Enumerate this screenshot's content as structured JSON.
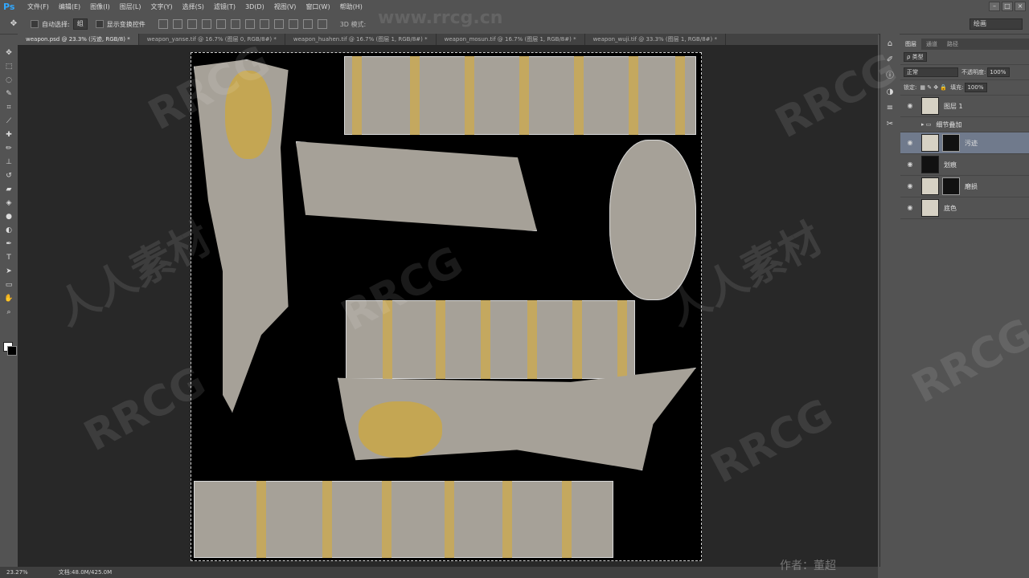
{
  "app": {
    "logo": "Ps"
  },
  "menu": [
    "文件(F)",
    "编辑(E)",
    "图像(I)",
    "图层(L)",
    "文字(Y)",
    "选择(S)",
    "滤镜(T)",
    "3D(D)",
    "视图(V)",
    "窗口(W)",
    "帮助(H)"
  ],
  "window_controls": [
    "–",
    "□",
    "×"
  ],
  "options": {
    "auto_select_label": "自动选择:",
    "auto_select_value": "组",
    "show_transform_label": "显示变换控件",
    "mode3d_label": "3D 模式:",
    "workspace": "绘画"
  },
  "tabs": [
    "weapon.psd @ 23.3% (污迹, RGB/8) *",
    "weapon_yanse.tif @ 16.7% (图层 0, RGB/8#) *",
    "weapon_huahen.tif @ 16.7% (图层 1, RGB/8#) *",
    "weapon_mosun.tif @ 16.7% (图层 1, RGB/8#) *",
    "weapon_wuji.tif @ 33.3% (图层 1, RGB/8#) *"
  ],
  "tools": [
    "move-icon",
    "marquee-icon",
    "lasso-icon",
    "quick-select-icon",
    "crop-icon",
    "eyedropper-icon",
    "healing-icon",
    "brush-icon",
    "clone-stamp-icon",
    "history-brush-icon",
    "eraser-icon",
    "paint-bucket-icon",
    "blur-icon",
    "dodge-icon",
    "pen-icon",
    "type-icon",
    "path-select-icon",
    "shape-icon",
    "hand-icon",
    "zoom-icon"
  ],
  "status": {
    "zoom": "23.27%",
    "doc": "文档:48.0M/425.0M"
  },
  "layers_panel": {
    "tabs": [
      "图层",
      "通道",
      "路径"
    ],
    "filter": "ρ 类型",
    "blend_mode": "正常",
    "opacity_label": "不透明度:",
    "opacity": "100%",
    "lock_label": "锁定:",
    "fill_label": "填充:",
    "fill": "100%",
    "layers": [
      {
        "name": "图层 1",
        "selected": false
      },
      {
        "name": "细节叠加",
        "selected": false
      },
      {
        "name": "污迹",
        "selected": true
      },
      {
        "name": "划痕",
        "selected": false
      },
      {
        "name": "磨损",
        "selected": false
      },
      {
        "name": "底色",
        "selected": false
      }
    ]
  },
  "watermarks": [
    "RRCG",
    "人人素材"
  ],
  "site_watermark": "www.rrcg.cn",
  "credit": "作者：董超"
}
